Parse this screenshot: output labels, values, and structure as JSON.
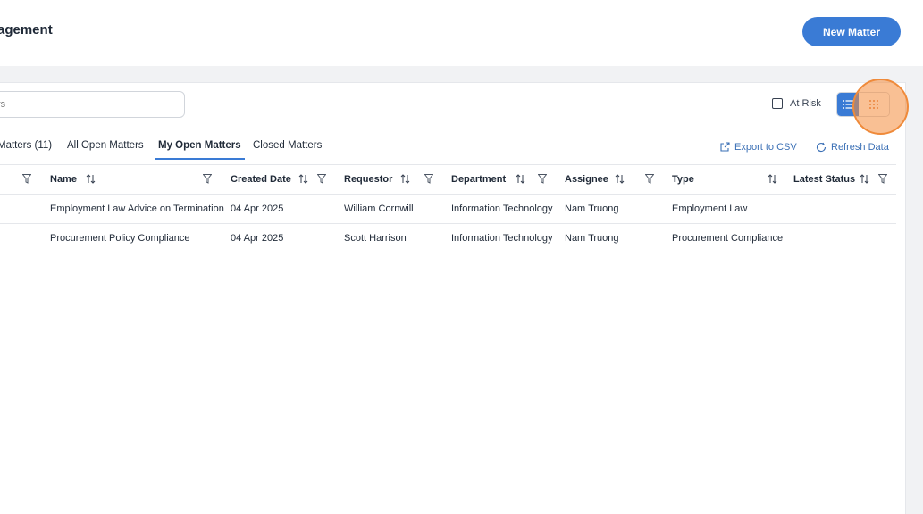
{
  "header": {
    "title": "agement",
    "new_matter_label": "New Matter"
  },
  "toolbar": {
    "search_placeholder": "rs",
    "at_risk_label": "At Risk"
  },
  "tabs": [
    {
      "label": "Matters (11)"
    },
    {
      "label": "All Open Matters"
    },
    {
      "label": "My Open Matters",
      "active": true
    },
    {
      "label": "Closed Matters"
    }
  ],
  "actions": {
    "export_label": "Export to CSV",
    "refresh_label": "Refresh Data"
  },
  "table": {
    "columns": [
      "Name",
      "Created Date",
      "Requestor",
      "Department",
      "Assignee",
      "Type",
      "Latest Status"
    ],
    "rows": [
      [
        "Employment Law Advice on Termination",
        "04 Apr 2025",
        "William Cornwill",
        "Information Technology",
        "Nam Truong",
        "Employment Law",
        ""
      ],
      [
        "Procurement Policy Compliance",
        "04 Apr 2025",
        "Scott Harrison",
        "Information Technology",
        "Nam Truong",
        "Procurement Compliance",
        ""
      ]
    ]
  },
  "colors": {
    "accent": "#3a7bd5",
    "link": "#3a6fb5",
    "highlight": "#ef8a3a"
  }
}
